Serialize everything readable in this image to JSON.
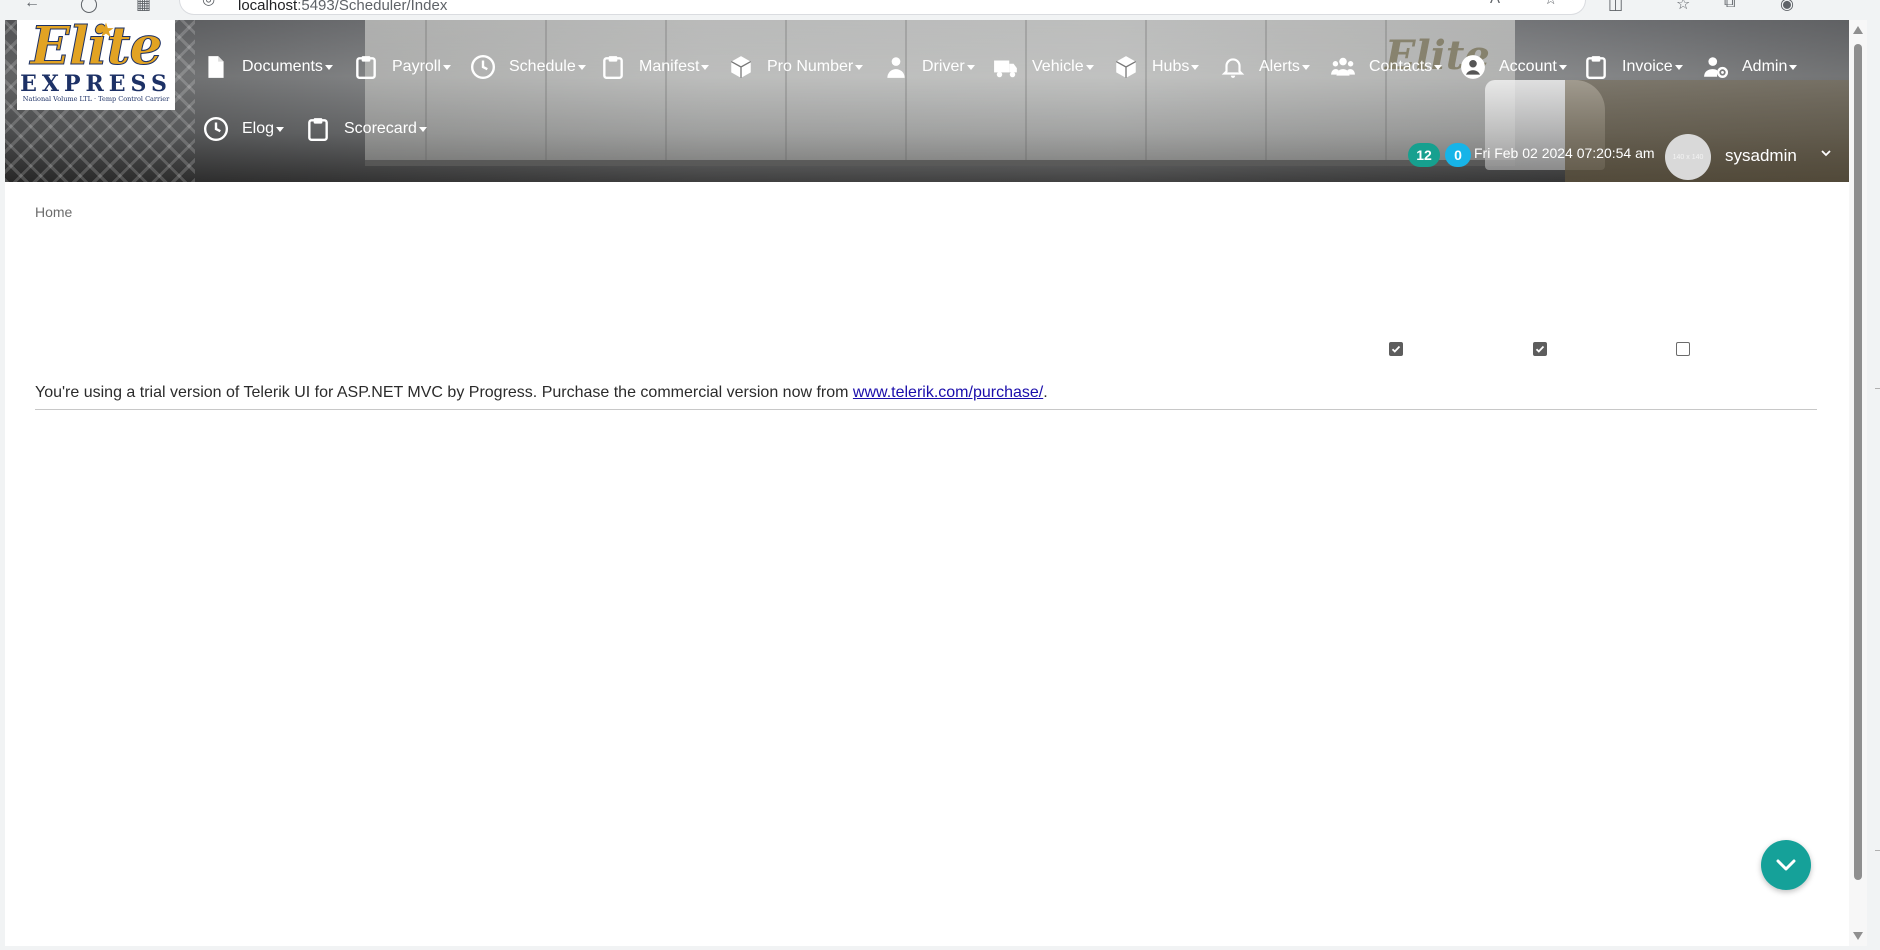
{
  "browser": {
    "url_host": "localhost",
    "url_rest": ":5493/Scheduler/Index",
    "nav_icons": [
      "back-icon",
      "reload-icon",
      "apps-icon"
    ],
    "address_icons": [
      "site-info-icon",
      "translate-icon",
      "bookmark-star-icon"
    ],
    "toolbar_icons": [
      "split-screen-icon",
      "favorites-icon",
      "collections-icon",
      "extension-icon"
    ]
  },
  "logo": {
    "name": "Elite",
    "subtitle": "EXPRESS",
    "tagline": "National Volume LTL · Temp Control Carrier"
  },
  "nav": {
    "items": [
      {
        "label": "Documents",
        "icon": "document-icon"
      },
      {
        "label": "Payroll",
        "icon": "clipboard-icon"
      },
      {
        "label": "Schedule",
        "icon": "clock-icon"
      },
      {
        "label": "Manifest",
        "icon": "clipboard-icon"
      },
      {
        "label": "Pro Number",
        "icon": "box-icon"
      },
      {
        "label": "Driver",
        "icon": "driver-icon"
      },
      {
        "label": "Vehicle",
        "icon": "truck-icon"
      },
      {
        "label": "Hubs",
        "icon": "box-icon"
      },
      {
        "label": "Alerts",
        "icon": "bell-icon"
      },
      {
        "label": "Contacts",
        "icon": "users-icon"
      },
      {
        "label": "Account",
        "icon": "user-circle-icon"
      },
      {
        "label": "Invoice",
        "icon": "clipboard-icon"
      },
      {
        "label": "Admin",
        "icon": "user-gear-icon"
      },
      {
        "label": "Elog",
        "icon": "clock-icon"
      },
      {
        "label": "Scorecard",
        "icon": "clipboard-icon"
      }
    ]
  },
  "status": {
    "badge_green": "12",
    "badge_blue": "0",
    "datetime": "Fri Feb 02 2024 07:20:54 am",
    "avatar_placeholder": "140 x 140",
    "username": "sysadmin"
  },
  "page": {
    "breadcrumb": "Home",
    "checkboxes": [
      {
        "name": "checkbox-1",
        "checked": true
      },
      {
        "name": "checkbox-2",
        "checked": true
      },
      {
        "name": "checkbox-3",
        "checked": false
      }
    ],
    "trial_text": "You're using a trial version of Telerik UI for ASP.NET MVC by Progress. Purchase the commercial version now from ",
    "trial_link": "www.telerik.com/purchase/",
    "trial_end": "."
  },
  "colors": {
    "badge_green": "#16a08f",
    "badge_blue": "#17b4e8",
    "fab": "#15a199",
    "logo_gold": "#e2a323",
    "logo_navy": "#1d3166"
  }
}
